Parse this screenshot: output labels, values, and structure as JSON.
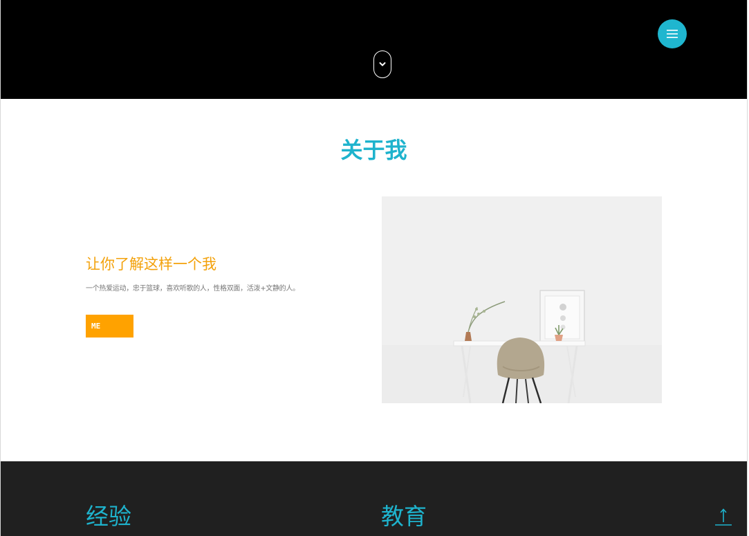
{
  "header": {
    "menu_icon": "hamburger-icon",
    "scroll_icon": "chevron-down-icon",
    "accent_color": "#1fb6cf"
  },
  "about": {
    "title": "关于我",
    "subtitle": "让你了解这样一个我",
    "description": "一个热爱运动，忠于篮球，喜欢听歌的人，性格双面，活泼+文静的人。",
    "button_label": "ME",
    "button_color": "#ffa200",
    "image": "desk-chair-photo"
  },
  "sections": {
    "experience_title": "经验",
    "education_title": "教育",
    "background_color": "#202020"
  },
  "back_to_top_icon": "arrow-up-icon"
}
